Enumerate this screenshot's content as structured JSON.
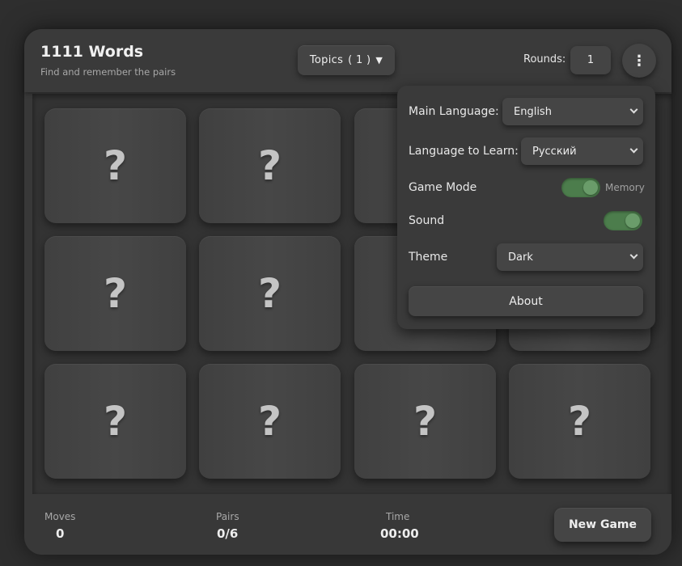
{
  "header": {
    "title": "1111 Words",
    "subtitle": "Find and remember the pairs",
    "topics_label": "Topics",
    "topics_count": "( 1 )",
    "topics_arrow": "▼",
    "rounds_label": "Rounds:",
    "rounds_value": "1",
    "menu_icon": "⋮"
  },
  "board": {
    "cards": [
      "?",
      "?",
      "?",
      "?",
      "?",
      "?",
      "?",
      "?",
      "?",
      "?"
    ]
  },
  "footer": {
    "moves_label": "Moves",
    "moves_value": "0",
    "pairs_label": "Pairs",
    "pairs_value": "0/6",
    "time_label": "Time",
    "time_value": "00:00",
    "new_game_label": "New Game"
  },
  "settings": {
    "main_language_label": "Main Language:",
    "main_language_value": "English",
    "learn_language_label": "Language to Learn:",
    "learn_language_value": "Русский",
    "game_mode_label": "Game Mode",
    "game_mode_value": "Memory",
    "game_mode_on": true,
    "sound_label": "Sound",
    "sound_on": true,
    "theme_label": "Theme",
    "theme_value": "Dark",
    "about_label": "About"
  },
  "colors": {
    "background": "#2e2e2e",
    "surface": "#383838",
    "toggle_on": "#4c7d4c",
    "text": "#e6e6e6"
  }
}
